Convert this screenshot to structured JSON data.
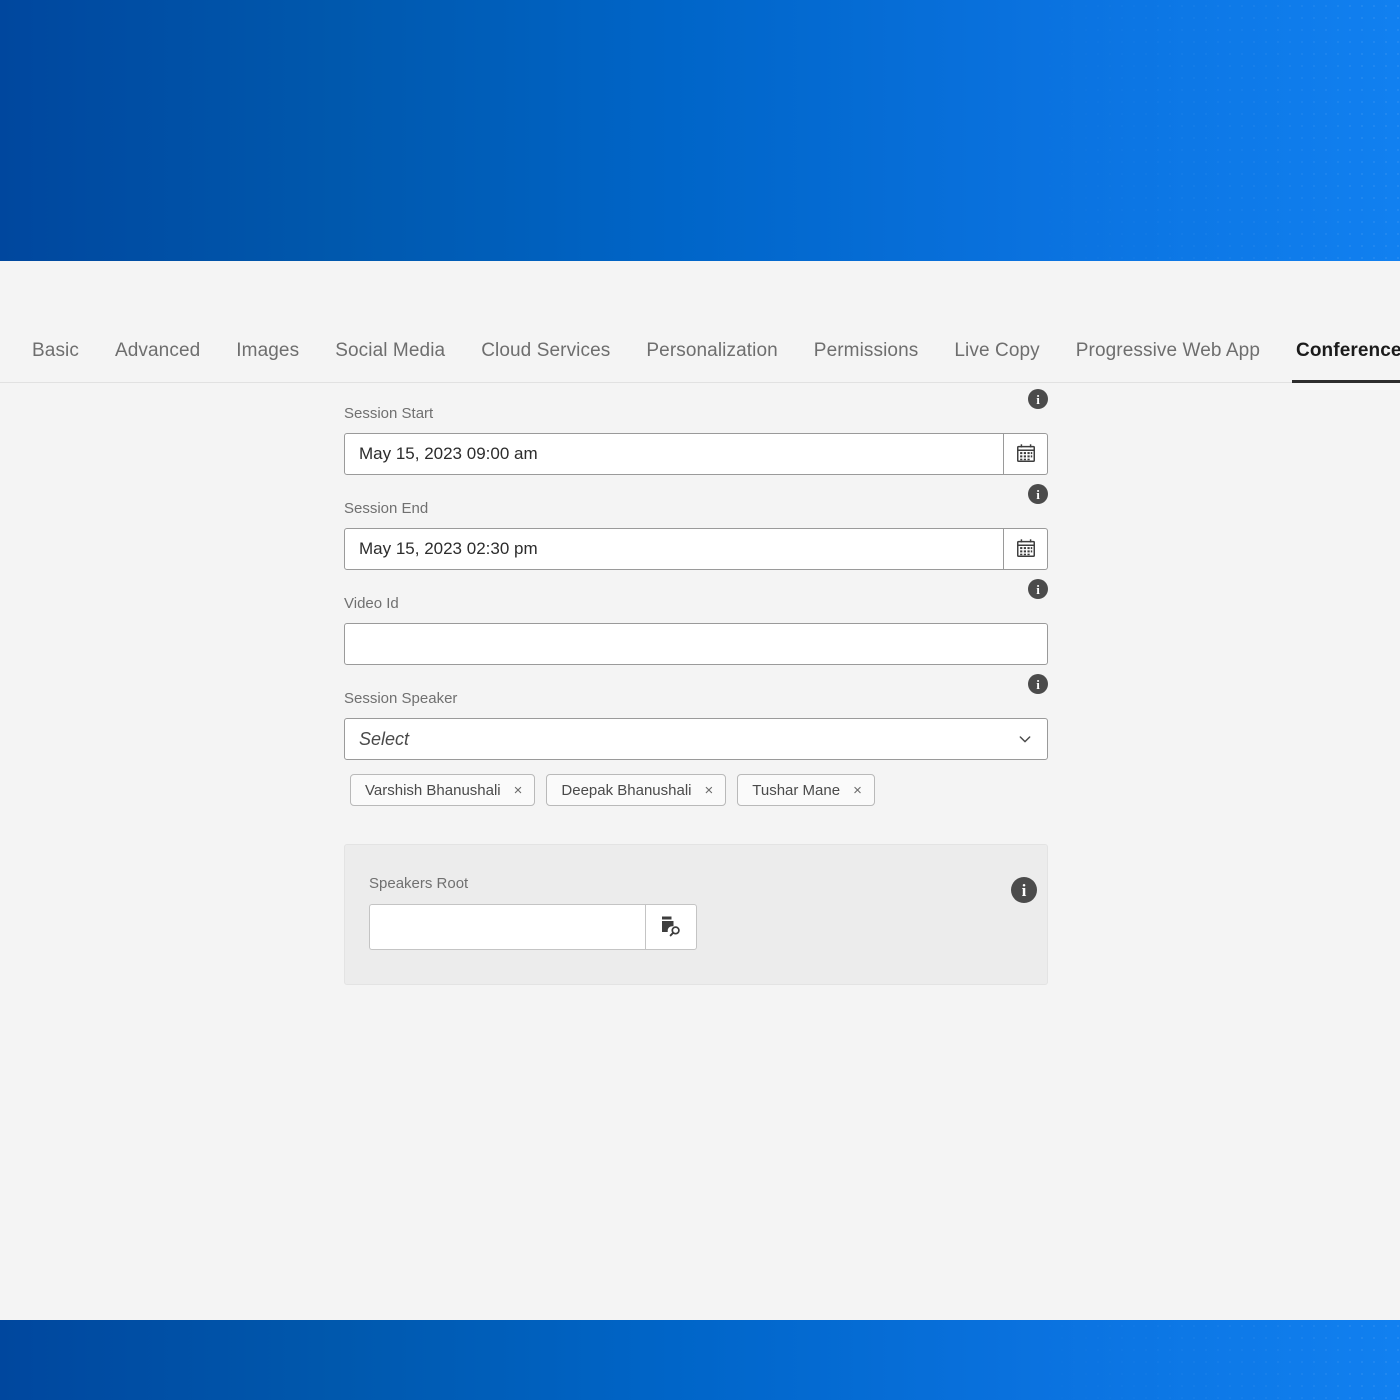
{
  "theme": {
    "band_gradient_start": "#00479e",
    "band_gradient_end": "#1180f0",
    "surface_bg": "#f4f4f4",
    "panel_bg": "#ececec",
    "active_tab_underline": "#2c2c2c",
    "label_color": "#707070"
  },
  "tabs": [
    {
      "label": "Basic",
      "active": false
    },
    {
      "label": "Advanced",
      "active": false
    },
    {
      "label": "Images",
      "active": false
    },
    {
      "label": "Social Media",
      "active": false
    },
    {
      "label": "Cloud Services",
      "active": false
    },
    {
      "label": "Personalization",
      "active": false
    },
    {
      "label": "Permissions",
      "active": false
    },
    {
      "label": "Live Copy",
      "active": false
    },
    {
      "label": "Progressive Web App",
      "active": false
    },
    {
      "label": "Conference Settings",
      "active": true
    }
  ],
  "form": {
    "session_start": {
      "label": "Session Start",
      "value": "May 15, 2023 09:00 am",
      "placeholder": "",
      "info_icon": "info-icon",
      "button_icon": "calendar-icon"
    },
    "session_end": {
      "label": "Session End",
      "value": "May 15, 2023 02:30 pm",
      "placeholder": "",
      "info_icon": "info-icon",
      "button_icon": "calendar-icon"
    },
    "video_id": {
      "label": "Video Id",
      "value": "",
      "placeholder": "",
      "info_icon": "info-icon"
    },
    "session_speaker": {
      "label": "Session Speaker",
      "selected": "Select",
      "info_icon": "info-icon",
      "chevron_icon": "chevron-down-icon",
      "chips": [
        {
          "label": "Varshish Bhanushali",
          "remove_icon": "close-icon",
          "remove_glyph": "×"
        },
        {
          "label": "Deepak Bhanushali",
          "remove_icon": "close-icon",
          "remove_glyph": "×"
        },
        {
          "label": "Tushar Mane",
          "remove_icon": "close-icon",
          "remove_glyph": "×"
        }
      ]
    },
    "speakers_root": {
      "label": "Speakers Root",
      "value": "",
      "placeholder": "",
      "info_icon": "info-icon",
      "button_icon": "browse-folder-search-icon"
    }
  }
}
